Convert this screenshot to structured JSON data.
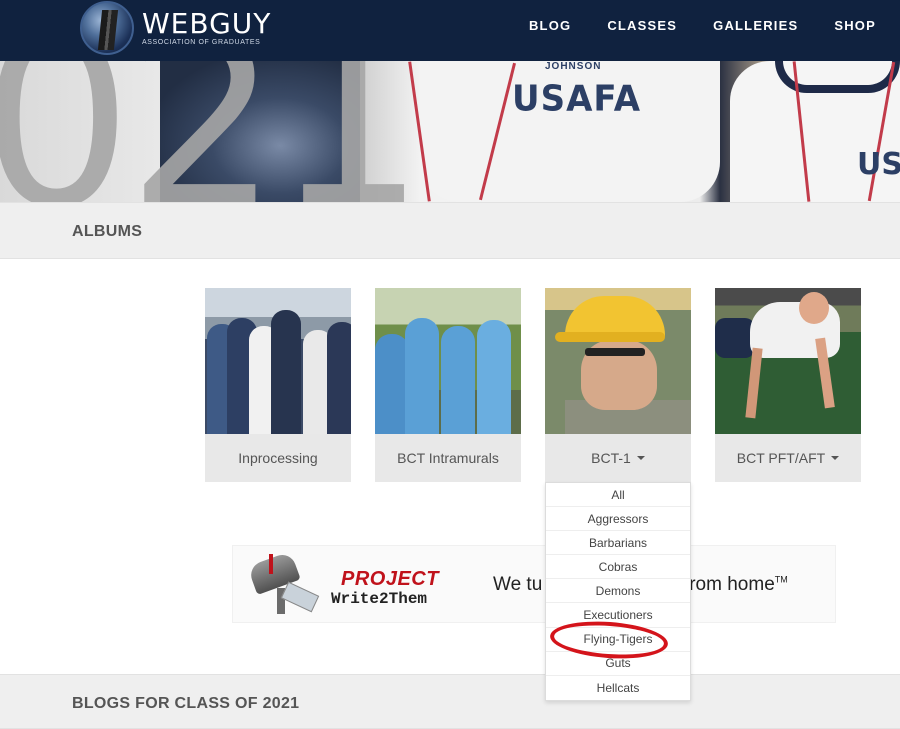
{
  "brand": {
    "name": "WEBGUY",
    "subtitle": "ASSOCIATION OF GRADUATES"
  },
  "nav": {
    "items": [
      {
        "label": "BLOG"
      },
      {
        "label": "CLASSES"
      },
      {
        "label": "GALLERIES"
      },
      {
        "label": "SHOP"
      }
    ]
  },
  "hero": {
    "shirt_text": "USAFA",
    "name_tag": "JOHNSON",
    "shirt_text_2": "US",
    "big_digits": "021"
  },
  "albums": {
    "heading": "ALBUMS",
    "cards": [
      {
        "label": "Inprocessing"
      },
      {
        "label": "BCT Intramurals"
      },
      {
        "label": "BCT-1"
      },
      {
        "label": "BCT PFT/AFT"
      }
    ],
    "dropdown_items": [
      "All",
      "Aggressors",
      "Barbarians",
      "Cobras",
      "Demons",
      "Executioners",
      "Flying-Tigers",
      "Guts",
      "Hellcats"
    ],
    "highlighted_item": "Flying-Tigers",
    "highlight_color": "#d4141b"
  },
  "banner": {
    "line1": "PROJECT",
    "line2": "Write2Them",
    "tagline_visible_left": "We tu",
    "tagline_visible_right": "ers from home",
    "trademark": "TM"
  },
  "blogs": {
    "heading": "BLOGS FOR CLASS OF 2021"
  },
  "colors": {
    "nav_bg": "#10223f",
    "section_bg": "#efefef",
    "caption_bg": "#e8e8e8",
    "accent_red": "#c0121b"
  }
}
